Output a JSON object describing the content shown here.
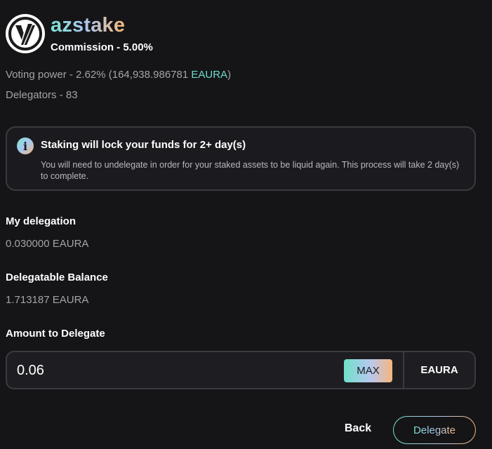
{
  "validator": {
    "name": "azstake",
    "commission": "Commission - 5.00%",
    "avatar_icon": "validator-logo-icon"
  },
  "stats": {
    "voting_power_prefix": "Voting power - 2.62%  (164,938.986781 ",
    "voting_power_denom": "EAURA",
    "voting_power_suffix": ")",
    "delegators": "Delegators - 83"
  },
  "notice": {
    "icon": "info-icon",
    "icon_glyph": "i",
    "title": "Staking will lock your funds for 2+ day(s)",
    "body": "You will need to undelegate in order for your staked assets to be liquid again. This process will take 2 day(s) to complete."
  },
  "my_delegation": {
    "label": "My delegation",
    "value": "0.030000 EAURA"
  },
  "balance": {
    "label": "Delegatable Balance",
    "value": "1.713187 EAURA"
  },
  "amount": {
    "label": "Amount to Delegate",
    "value": "0.06",
    "max_label": "MAX",
    "denom": "EAURA"
  },
  "actions": {
    "back_label": "Back",
    "delegate_label": "Delegate"
  },
  "colors": {
    "background": "#151518",
    "accent_teal": "#6fdcc8",
    "accent_orange": "#f7b87a",
    "border": "#3a3a40"
  }
}
